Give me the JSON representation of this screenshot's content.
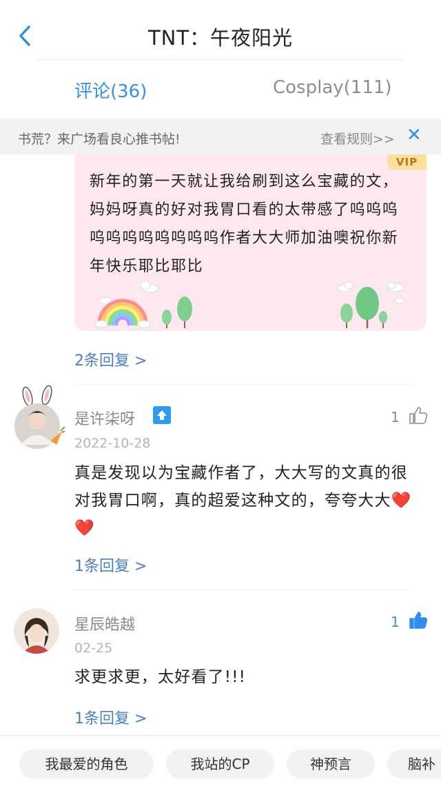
{
  "header": {
    "title": "TNT：午夜阳光"
  },
  "tabs": [
    {
      "label": "评论(36)",
      "active": true
    },
    {
      "label": "Cosplay(111)",
      "active": false
    }
  ],
  "banner": {
    "text": "书荒？来广场看良心推书帖!",
    "rules": "查看规则>>"
  },
  "vip_comment": {
    "badge": "VIP",
    "text": "新年的第一天就让我给刷到这么宝藏的文，妈妈呀真的好对我胃口看的太带感了呜呜呜呜呜呜呜呜呜呜呜作者大大师加油噢祝你新年快乐耶比耶比",
    "replies": "2条回复 >"
  },
  "comments": [
    {
      "username": "是许柒呀",
      "date": "2022-10-28",
      "likes": "1",
      "liked": false,
      "text": "真是发现以为宝藏作者了，大大写的文真的很对我胃口啊，真的超爱这种文的，夸夸大大❤️❤️",
      "replies": "1条回复 >"
    },
    {
      "username": "星辰皓越",
      "date": "02-25",
      "likes": "1",
      "liked": true,
      "text": "求更求更，太好看了!!!",
      "replies": "1条回复 >"
    }
  ],
  "tags": [
    "我最爱的角色",
    "我站的CP",
    "神预言",
    "脑补"
  ],
  "colors": {
    "accent": "#3a8fe0",
    "vip_bg": "#fce8ee",
    "vip_badge": "#fbdf9a",
    "link": "#4a7fc0"
  }
}
